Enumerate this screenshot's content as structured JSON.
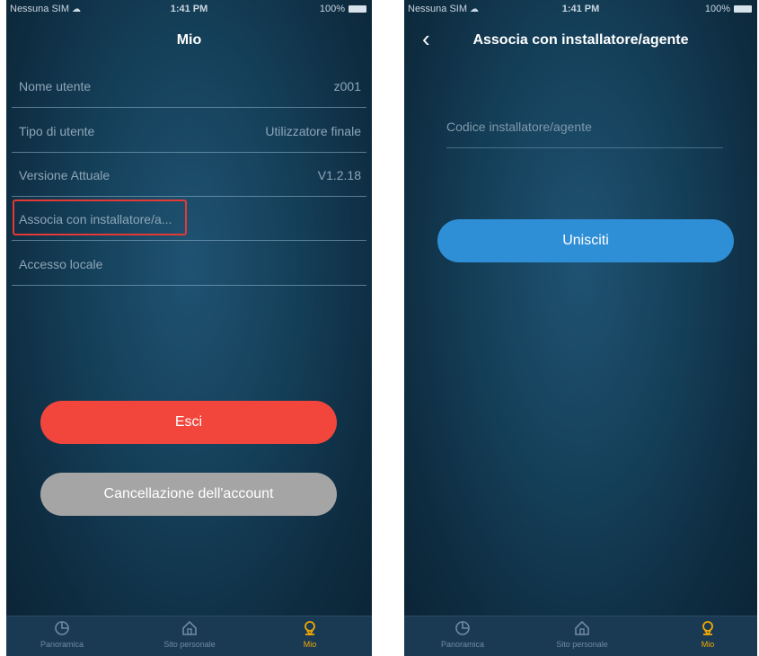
{
  "left": {
    "status": {
      "carrier": "Nessuna SIM",
      "time": "1:41 PM",
      "battery": "100%"
    },
    "title": "Mio",
    "rows": [
      {
        "label": "Nome utente",
        "value": "z001"
      },
      {
        "label": "Tipo di utente",
        "value": "Utilizzatore finale"
      },
      {
        "label": "Versione Attuale",
        "value": "V1.2.18"
      },
      {
        "label": "Associa con installatore/a...",
        "value": ""
      },
      {
        "label": "Accesso locale",
        "value": ""
      }
    ],
    "logout_label": "Esci",
    "delete_label": "Cancellazione dell'account",
    "tabs": [
      {
        "label": "Panoramica",
        "icon": "pie-chart-icon"
      },
      {
        "label": "Sito personale",
        "icon": "home-icon"
      },
      {
        "label": "Mio",
        "icon": "user-icon",
        "active": true
      }
    ]
  },
  "right": {
    "status": {
      "carrier": "Nessuna SIM",
      "time": "1:41 PM",
      "battery": "100%"
    },
    "title": "Associa con installatore/agente",
    "field_placeholder": "Codice installatore/agente",
    "join_label": "Unisciti",
    "tabs": [
      {
        "label": "Panoramica",
        "icon": "pie-chart-icon"
      },
      {
        "label": "Sito personale",
        "icon": "home-icon"
      },
      {
        "label": "Mio",
        "icon": "user-icon",
        "active": true
      }
    ]
  },
  "colors": {
    "accent_red": "#f2463c",
    "accent_blue": "#2f8fd6",
    "active_tab": "#f2a900",
    "highlight": "#e53935"
  }
}
